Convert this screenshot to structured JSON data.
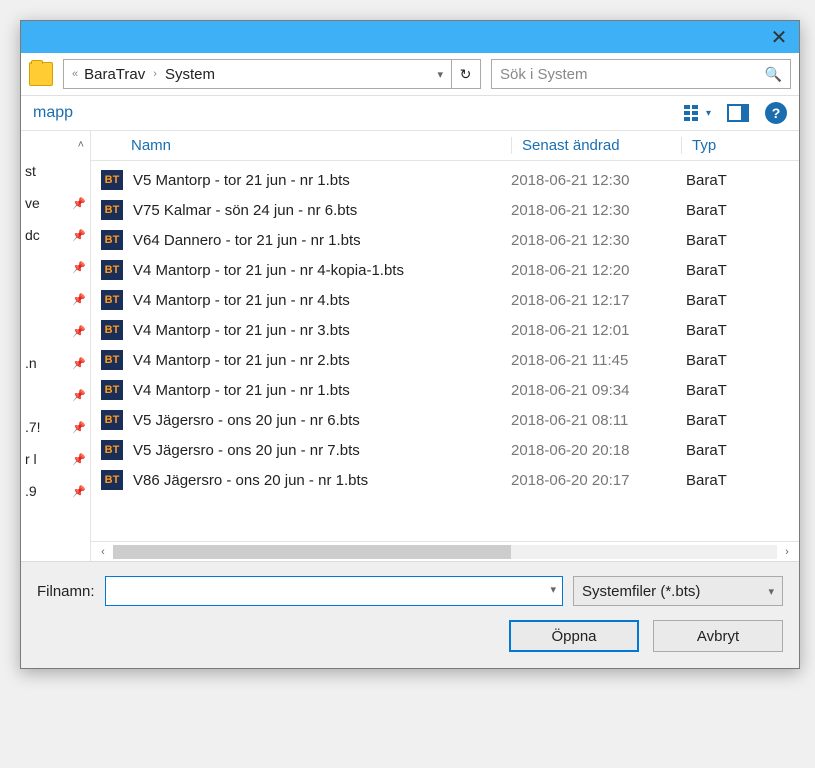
{
  "breadcrumb": {
    "root": "BaraTrav",
    "current": "System",
    "back_chevrons": "«"
  },
  "search": {
    "placeholder": "Sök i System"
  },
  "toolbar": {
    "label": "mapp"
  },
  "columns": {
    "name": "Namn",
    "modified": "Senast ändrad",
    "type": "Typ"
  },
  "nav": {
    "items": [
      {
        "label": "st",
        "pinned": false
      },
      {
        "label": "ve",
        "pinned": true
      },
      {
        "label": "dc",
        "pinned": true
      },
      {
        "label": "",
        "pinned": true
      },
      {
        "label": "",
        "pinned": true
      },
      {
        "label": "",
        "pinned": true
      },
      {
        "label": ".n",
        "pinned": true
      },
      {
        "label": "",
        "pinned": true
      },
      {
        "label": ".7!",
        "pinned": true
      },
      {
        "label": "r l",
        "pinned": true
      },
      {
        "label": ".9",
        "pinned": true
      }
    ]
  },
  "files": [
    {
      "name": "V5 Mantorp - tor 21 jun - nr 1.bts",
      "modified": "2018-06-21 12:30",
      "type": "BaraT"
    },
    {
      "name": "V75 Kalmar - sön 24 jun - nr 6.bts",
      "modified": "2018-06-21 12:30",
      "type": "BaraT"
    },
    {
      "name": "V64 Dannero - tor 21 jun - nr 1.bts",
      "modified": "2018-06-21 12:30",
      "type": "BaraT"
    },
    {
      "name": "V4 Mantorp - tor 21 jun - nr 4-kopia-1.bts",
      "modified": "2018-06-21 12:20",
      "type": "BaraT"
    },
    {
      "name": "V4 Mantorp - tor 21 jun - nr 4.bts",
      "modified": "2018-06-21 12:17",
      "type": "BaraT"
    },
    {
      "name": "V4 Mantorp - tor 21 jun - nr 3.bts",
      "modified": "2018-06-21 12:01",
      "type": "BaraT"
    },
    {
      "name": "V4 Mantorp - tor 21 jun - nr 2.bts",
      "modified": "2018-06-21 11:45",
      "type": "BaraT"
    },
    {
      "name": "V4 Mantorp - tor 21 jun - nr 1.bts",
      "modified": "2018-06-21 09:34",
      "type": "BaraT"
    },
    {
      "name": "V5 Jägersro - ons 20 jun - nr 6.bts",
      "modified": "2018-06-21 08:11",
      "type": "BaraT"
    },
    {
      "name": "V5 Jägersro - ons 20 jun - nr 7.bts",
      "modified": "2018-06-20 20:18",
      "type": "BaraT"
    },
    {
      "name": "V86 Jägersro - ons 20 jun - nr 1.bts",
      "modified": "2018-06-20 20:17",
      "type": "BaraT"
    }
  ],
  "footer": {
    "filename_label": "Filnamn:",
    "filter": "Systemfiler (*.bts)",
    "open": "Öppna",
    "cancel": "Avbryt"
  },
  "icons": {
    "bt": "BT"
  }
}
